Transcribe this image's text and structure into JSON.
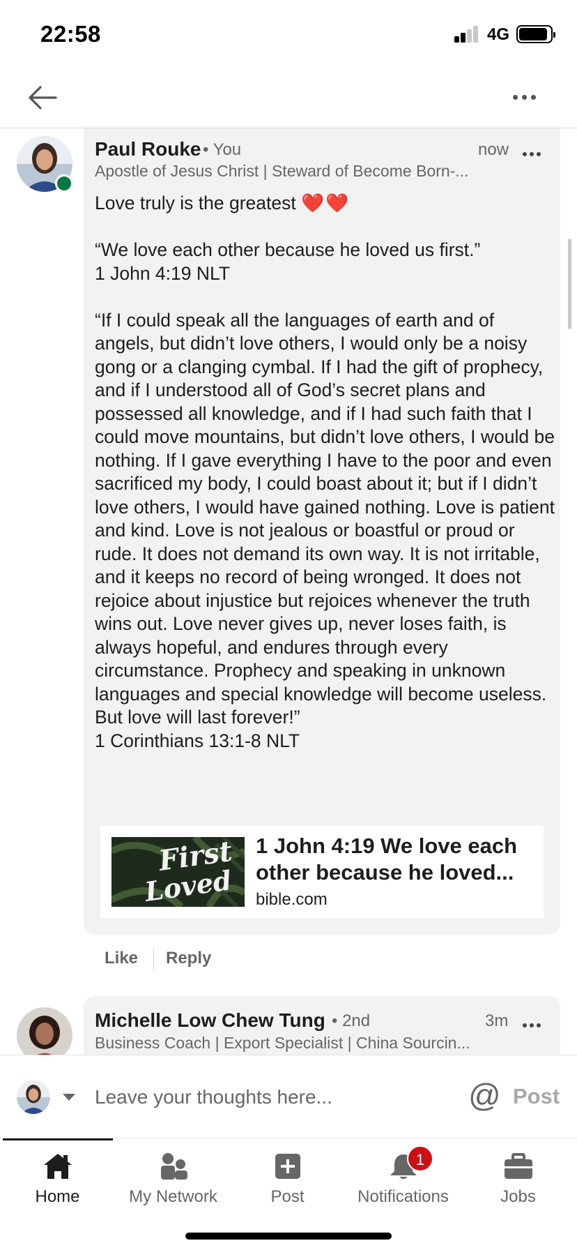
{
  "status_bar": {
    "time": "22:58",
    "network": "4G"
  },
  "nav": {
    "back_icon": "arrow-left-icon",
    "more_icon": "more-horizontal-icon"
  },
  "comments": [
    {
      "author": "Paul Rouke",
      "degree": "• You",
      "time": "now",
      "headline": "Apostle of Jesus Christ | Steward of Become Born-...",
      "online": true,
      "body": {
        "line1": "Love truly is the greatest",
        "hearts": "❤️❤️",
        "quote1": "“We love each other because he loved us first.”",
        "ref1": "1 John 4:19 NLT",
        "quote2": "“If I could speak all the languages of earth and of angels, but didn’t love others, I would only be a noisy gong or a clanging cymbal. If I had the gift of prophecy, and if I understood all of God’s secret plans and possessed all knowledge, and if I had such faith that I could move mountains, but didn’t love others, I would be nothing. If I gave everything I have to the poor and even sacrificed my body, I could boast about it; but if I didn’t love others, I would have gained nothing. Love is patient and kind. Love is not jealous or boastful or proud or rude. It does not demand its own way. It is not irritable, and it keeps no record of being wronged. It does not rejoice about injustice but rejoices whenever the truth wins out. Love never gives up, never loses faith, is always hopeful, and endures through every circumstance. Prophecy and speaking in unknown languages and special knowledge will become useless. But love will last forever!”",
        "ref2": "1 Corinthians 13:1-8 NLT"
      },
      "link_preview": {
        "title": "1 John 4:19 We love each other because he loved...",
        "domain": "bible.com"
      },
      "actions": {
        "like": "Like",
        "reply": "Reply"
      }
    },
    {
      "author": "Michelle Low Chew Tung",
      "degree": "• 2nd",
      "time": "3m",
      "headline": "Business Coach | Export Specialist | China Sourcin..."
    }
  ],
  "composer": {
    "placeholder": "Leave your thoughts here...",
    "mention_symbol": "@",
    "post_label": "Post"
  },
  "tabbar": {
    "tabs": [
      {
        "label": "Home",
        "icon": "home-icon",
        "active": true
      },
      {
        "label": "My Network",
        "icon": "network-icon",
        "active": false
      },
      {
        "label": "Post",
        "icon": "plus-square-icon",
        "active": false
      },
      {
        "label": "Notifications",
        "icon": "bell-icon",
        "active": false,
        "badge": "1"
      },
      {
        "label": "Jobs",
        "icon": "briefcase-icon",
        "active": false
      }
    ]
  },
  "colors": {
    "comment_bg": "#f2f2f2",
    "badge_red": "#cc1016",
    "online_green": "#057642",
    "heart_red": "#e0202d"
  }
}
